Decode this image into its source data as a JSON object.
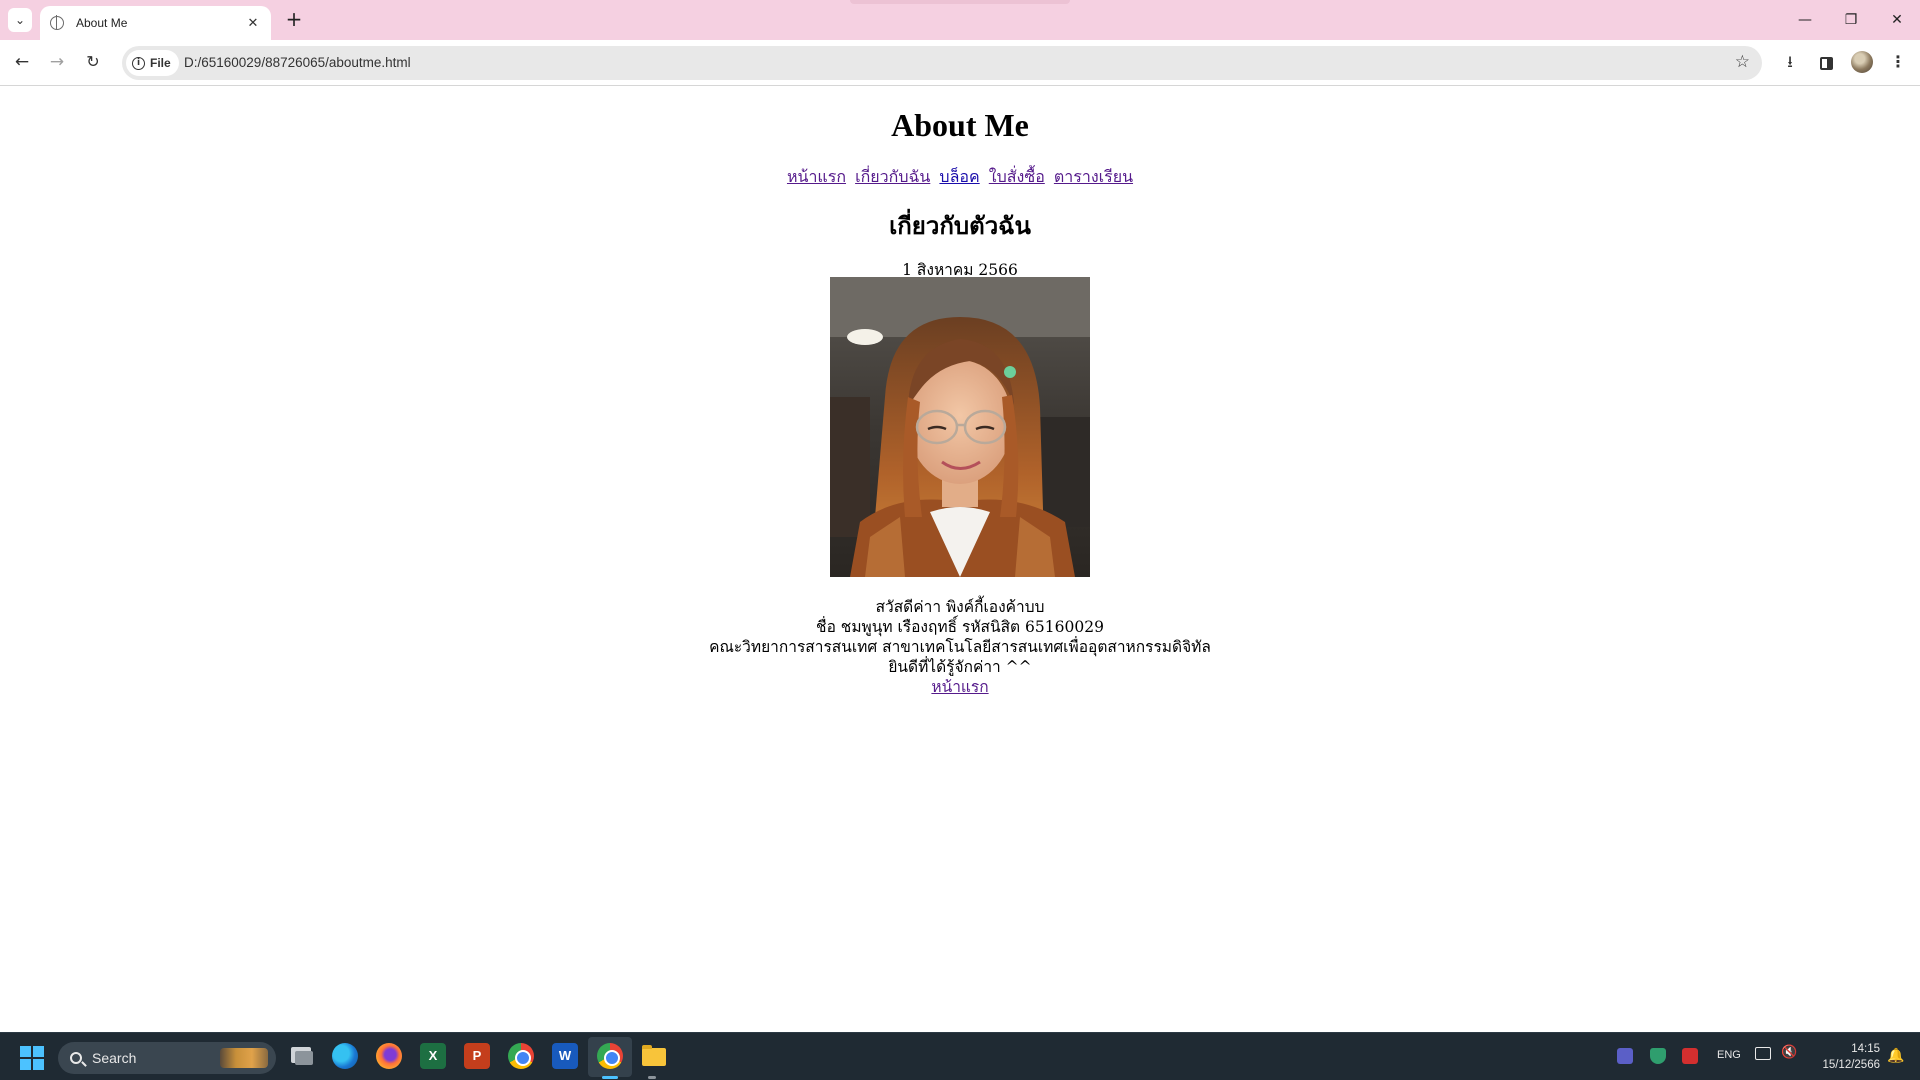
{
  "browser": {
    "tab_title": "About Me",
    "new_tab_symbol": "+",
    "omnibox_chip": "File",
    "url": "D:/65160029/88726065/aboutme.html"
  },
  "page": {
    "title": "About Me",
    "nav_links": [
      {
        "label": "หน้าแรก",
        "visited": true
      },
      {
        "label": "เกี่ยวกับฉัน",
        "visited": true
      },
      {
        "label": "บล็อค",
        "visited": false
      },
      {
        "label": "ใบสั่งซื้อ",
        "visited": true
      },
      {
        "label": "ตารางเรียน",
        "visited": true
      }
    ],
    "section_title": "เกี่ยวกับตัวฉัน",
    "date": "1 สิงหาคม 2566",
    "bio_lines": [
      "สวัสดีค่าา พิงค์กี้เองค้าบบ",
      "ชื่อ ชมพูนุท เรืองฤทธิ์ รหัสนิสิต 65160029",
      "คณะวิทยาการสารสนเทศ สาขาเทคโนโลยีสารสนเทศเพื่ออุตสาหกรรมดิจิทัล",
      "ยินดีที่ได้รู้จักค่าา ^^"
    ],
    "home_link": "หน้าแรก"
  },
  "taskbar": {
    "search_label": "Search",
    "language": "ENG",
    "time": "14:15",
    "date": "15/12/2566"
  },
  "colors": {
    "tabbar_bg": "#f5d0e1",
    "link_unvisited": "#1a0dab",
    "link_visited": "#551a8b",
    "taskbar_bg": "#1f2a33",
    "accent": "#4cc2ff"
  }
}
